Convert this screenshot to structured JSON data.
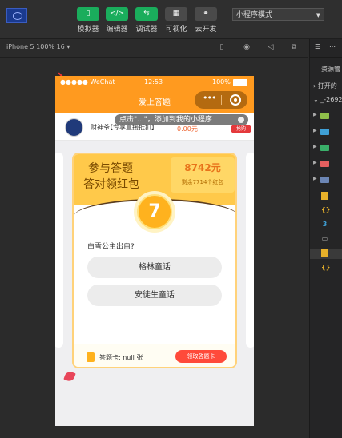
{
  "toolbar": {
    "buttons": [
      {
        "icon": "phone-icon",
        "label": "模拟器",
        "active": true
      },
      {
        "icon": "code-icon",
        "label": "编辑器",
        "active": true
      },
      {
        "icon": "debug-icon",
        "label": "调试器",
        "active": true
      },
      {
        "icon": "layout-icon",
        "label": "可视化",
        "active": false
      },
      {
        "icon": "cloud-icon",
        "label": "云开发",
        "active": false
      }
    ],
    "mode_select": "小程序模式"
  },
  "simulator": {
    "device": "iPhone 5 100% 16 ▾"
  },
  "explorer": {
    "title": "资源管",
    "open_editors": "打开的",
    "project": "_-2692"
  },
  "phone": {
    "status": {
      "carrier": "●●●●● WeChat",
      "time": "12:53",
      "battery": "100%"
    },
    "nav_title": "爱上答题",
    "tip": "点击\"...\"，添加到我的小程序",
    "ad": {
      "name": "财神爷",
      "desc": "【专享直接抵扣】",
      "price": "0.00元",
      "buy": "抢购"
    },
    "card": {
      "head_line1": "参与答题",
      "head_line2": "答对领红包",
      "money": "8742元",
      "money_sub": "剩余7714个红包",
      "number": "7",
      "question": "白雪公主出自?",
      "options": [
        "格林童话",
        "安徒生童话"
      ],
      "footer_text": "答题卡: null 张",
      "claim_button": "领取答题卡"
    }
  },
  "colors": {
    "accent": "#ff9a1f",
    "green": "#1aad5c",
    "red": "#ff4a3a"
  }
}
